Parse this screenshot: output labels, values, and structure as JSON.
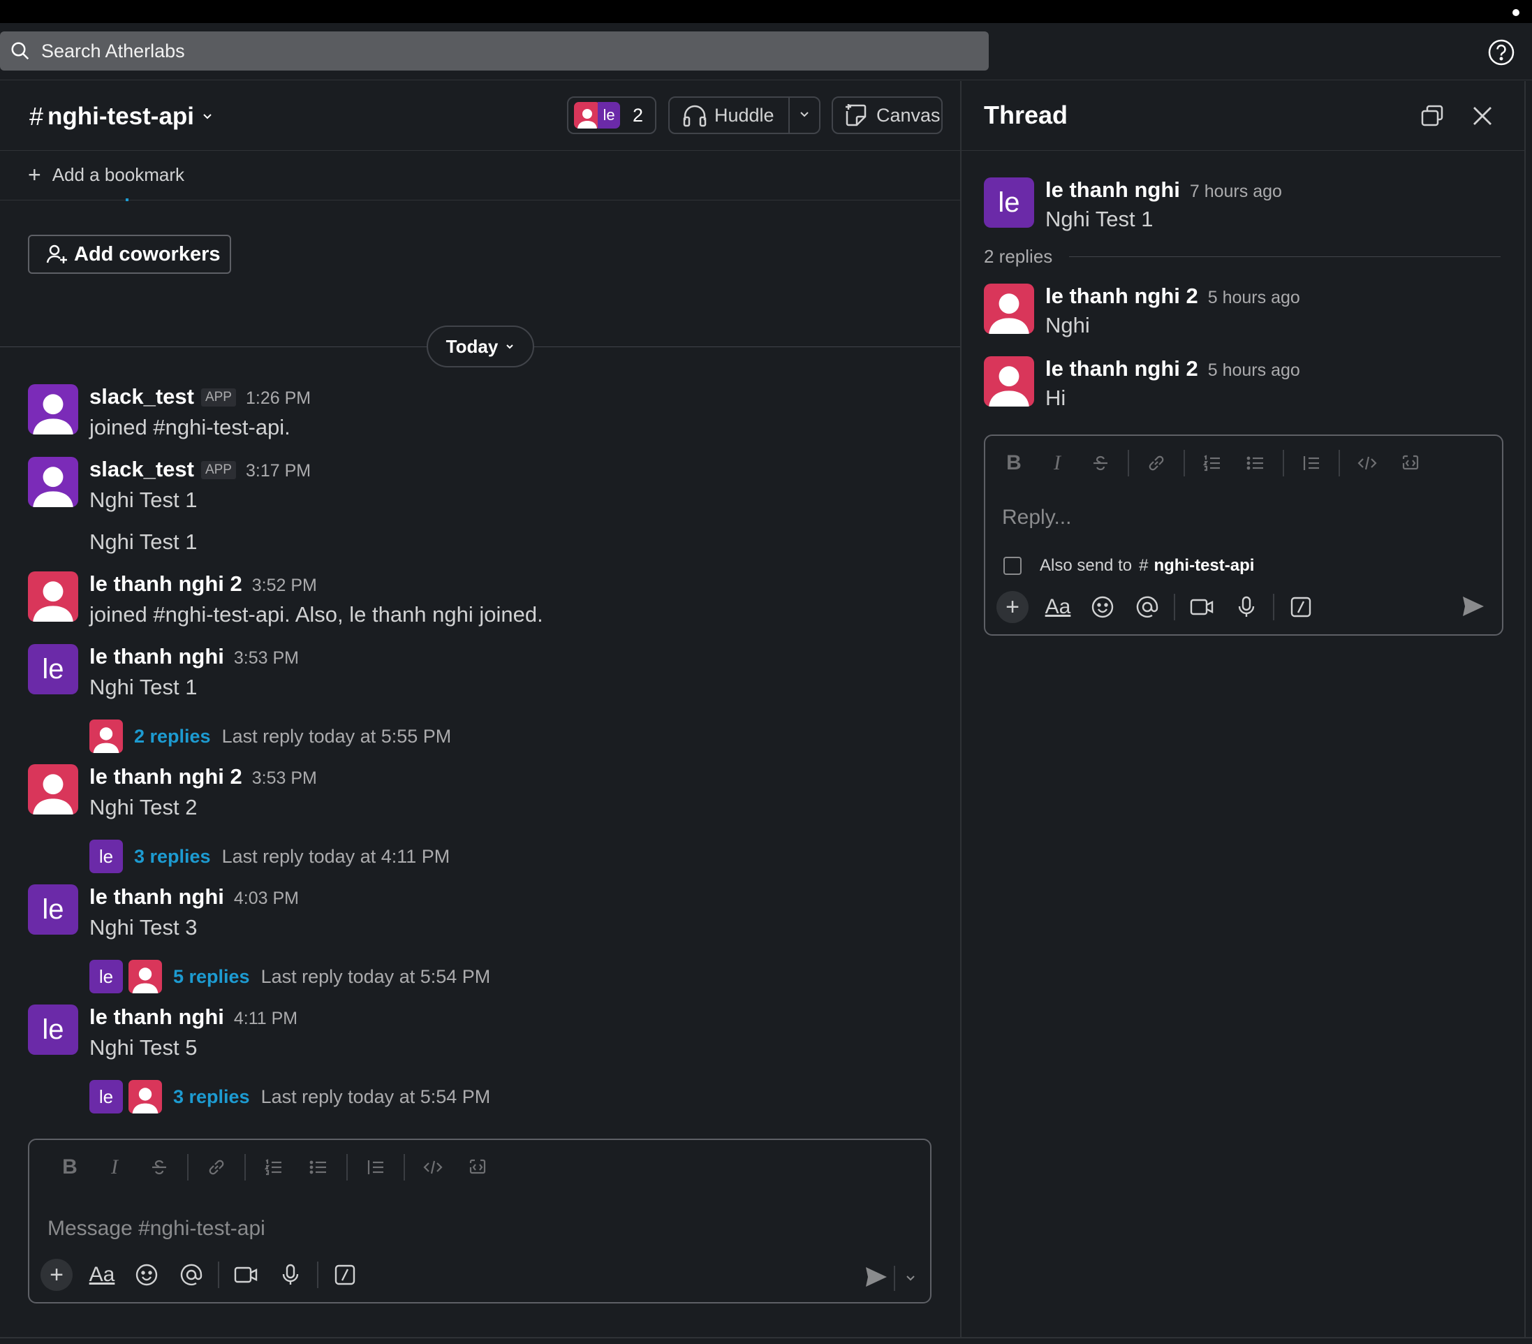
{
  "search": {
    "placeholder": "Search Atherlabs"
  },
  "channel": {
    "name": "nghi-test-api",
    "members_count": "2",
    "member_initials": "le",
    "huddle_label": "Huddle",
    "canvas_label": "Canvas",
    "add_bookmark": "Add a bookmark",
    "add_coworkers": "Add coworkers",
    "date_divider": "Today"
  },
  "messages": [
    {
      "user": "slack_test",
      "tag": "APP",
      "time": "1:26 PM",
      "text": "joined #nghi-test-api."
    },
    {
      "user": "slack_test",
      "tag": "APP",
      "time": "3:17 PM",
      "text": "Nghi Test 1",
      "text2": "Nghi Test 1"
    },
    {
      "user": "le thanh nghi 2",
      "time": "3:52 PM",
      "text": "joined #nghi-test-api. Also, le thanh nghi joined."
    },
    {
      "user": "le thanh nghi",
      "initials": "le",
      "time": "3:53 PM",
      "text": "Nghi Test 1",
      "replies": "2 replies",
      "last_reply": "Last reply today at 5:55 PM"
    },
    {
      "user": "le thanh nghi 2",
      "time": "3:53 PM",
      "text": "Nghi Test 2",
      "replies": "3 replies",
      "last_reply": "Last reply today at 4:11 PM",
      "reply_initials": "le"
    },
    {
      "user": "le thanh nghi",
      "initials": "le",
      "time": "4:03 PM",
      "text": "Nghi Test 3",
      "replies": "5 replies",
      "last_reply": "Last reply today at 5:54 PM",
      "reply_initials": "le"
    },
    {
      "user": "le thanh nghi",
      "initials": "le",
      "time": "4:11 PM",
      "text": "Nghi Test 5",
      "replies": "3 replies",
      "last_reply": "Last reply today at 5:54 PM",
      "reply_initials": "le"
    }
  ],
  "composer": {
    "placeholder": "Message #nghi-test-api"
  },
  "thread": {
    "title": "Thread",
    "parent": {
      "user": "le thanh nghi",
      "initials": "le",
      "time": "7 hours ago",
      "text": "Nghi Test 1"
    },
    "replies_label": "2 replies",
    "replies": [
      {
        "user": "le thanh nghi 2",
        "time": "5 hours ago",
        "text": "Nghi"
      },
      {
        "user": "le thanh nghi 2",
        "time": "5 hours ago",
        "text": "Hi"
      }
    ],
    "reply_placeholder": "Reply...",
    "also_send_prefix": "Also send to",
    "also_send_channel": "nghi-test-api"
  },
  "format_toolbar": {
    "bold": "B",
    "italic": "I",
    "text_style": "Aa"
  },
  "colors": {
    "background": "#1a1d21",
    "link": "#1d9bd1",
    "avatar_red": "#d9365a",
    "avatar_purple": "#6b2aa8"
  }
}
